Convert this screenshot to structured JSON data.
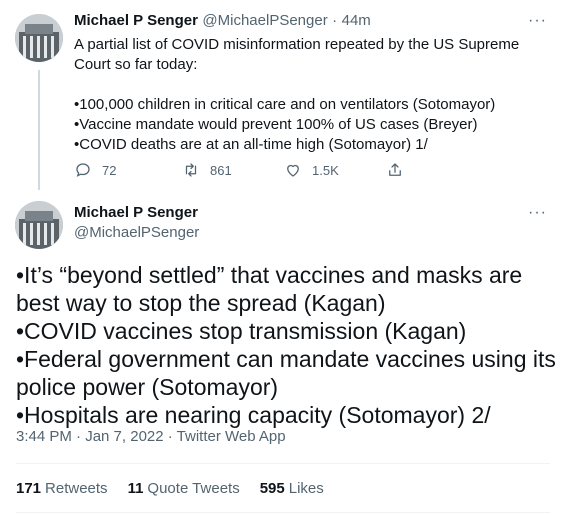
{
  "tweet1": {
    "name": "Michael P Senger",
    "handle": "@MichaelPSenger",
    "separator": "·",
    "time": "44m",
    "more": "···",
    "text": "A partial list of COVID misinformation repeated by the US Supreme Court so far today:\n\n•100,000 children in critical care and on ventilators (Sotomayor)\n•Vaccine mandate would prevent 100% of US cases (Breyer)\n•COVID deaths are at an all-time high (Sotomayor) 1/",
    "replies": "72",
    "retweets": "861",
    "likes": "1.5K",
    "icons": {
      "reply": "reply-icon",
      "retweet": "retweet-icon",
      "like": "like-icon",
      "share": "share-icon"
    }
  },
  "tweet2": {
    "name": "Michael P Senger",
    "handle": "@MichaelPSenger",
    "more": "···",
    "text": "•It’s “beyond settled” that vaccines and masks are best way to stop the spread (Kagan)\n•COVID vaccines stop transmission (Kagan)\n•Federal government can mandate vaccines using its police power (Sotomayor)\n•Hospitals are nearing capacity (Sotomayor) 2/",
    "timestamp": "3:44 PM · Jan 7, 2022 · Twitter Web App",
    "stats": {
      "retweets_count": "171",
      "retweets_label": "Retweets",
      "quotes_count": "11",
      "quotes_label": "Quote Tweets",
      "likes_count": "595",
      "likes_label": "Likes"
    }
  },
  "colors": {
    "text": "#0f1419",
    "muted": "#536471",
    "border": "#eff3f4",
    "thread": "#cfd9de"
  }
}
